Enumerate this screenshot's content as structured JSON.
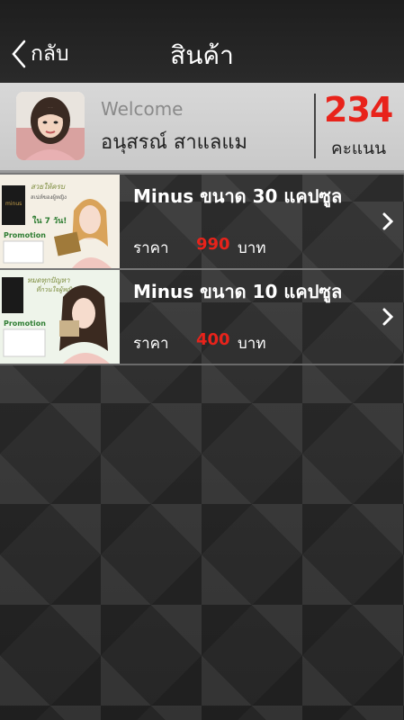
{
  "header": {
    "back_label": "กลับ",
    "title": "สินค้า"
  },
  "profile": {
    "welcome": "Welcome",
    "name": "อนุสรณ์ สาแลแม",
    "points": "234",
    "points_label": "คะแนน"
  },
  "products": [
    {
      "name": "Minus ขนาด 30 แคปซูล",
      "price_label": "ราคา",
      "price": "990",
      "currency": "บาท",
      "thumb_text": {
        "headline": "สวยให้ครบ",
        "sub": "สเน่ห์ของผู้หญิง",
        "tag": "ใน 7 วัน!",
        "promo": "Promotion"
      }
    },
    {
      "name": "Minus ขนาด 10 แคปซูล",
      "price_label": "ราคา",
      "price": "400",
      "currency": "บาท",
      "thumb_text": {
        "headline": "หมดทุกปัญหา",
        "sub": "ที่กวนใจผู้หญิง",
        "promo": "Promotion"
      }
    }
  ],
  "colors": {
    "accent_red": "#e8231b",
    "profile_bg": "#d0d0d0",
    "header_bg": "#1e1e1e"
  }
}
